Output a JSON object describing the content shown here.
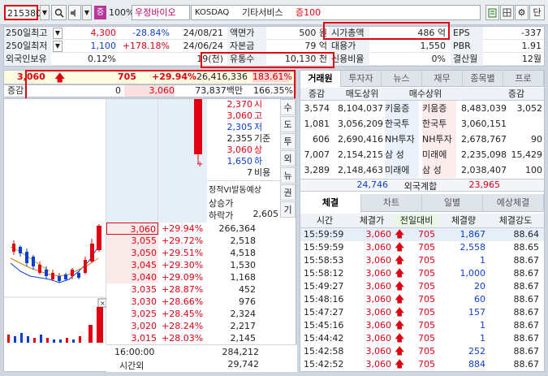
{
  "toolbar": {
    "code": "215380",
    "percent_label": "100%",
    "stock_name": "우정바이오",
    "market": "KOSDAQ",
    "sector": "기타서비스",
    "margin": "증100",
    "badge": "증",
    "right_button": "단"
  },
  "info": {
    "rows": [
      {
        "l1": "250일최고",
        "v1": "4,300",
        "p1": "-28.84%",
        "d1": "24/08/21",
        "l2": "액면가",
        "v2": "500 원",
        "l3": "시가총액",
        "v3": "486 억",
        "l4": "EPS",
        "v4": "-337"
      },
      {
        "l1": "250일최저",
        "v1": "1,100",
        "p1": "+178.18%",
        "d1": "24/06/24",
        "l2": "자본금",
        "v2": "79 억",
        "l3": "대용가",
        "v3": "1,550",
        "l4": "PBR",
        "v4": "1.91"
      },
      {
        "l1": "외국인보유",
        "v1": "0.12%",
        "p1": "",
        "d1": "19(천)",
        "l2": "유통수",
        "v2": "10,130 천",
        "l3": "신용비율",
        "v3": "0%",
        "l4": "결산월",
        "v4": "12월"
      }
    ]
  },
  "price": {
    "current": "3,060",
    "change": "705",
    "change_pct": "+29.94%",
    "volume": "26,416,336",
    "vol_ratio": "183.61%",
    "row2_label": "증감",
    "row2_a": "0",
    "row2_b": "3,060",
    "row2_c": "73,837백만",
    "row2_d": "166.35%"
  },
  "summary": {
    "lines": [
      {
        "v": "2,370",
        "l": "시"
      },
      {
        "v": "3,060",
        "l": "고"
      },
      {
        "v": "2,305",
        "l": "저"
      },
      {
        "v": "2,355",
        "l": "기준"
      },
      {
        "v": "3,060",
        "l": "상"
      },
      {
        "v": "1,650",
        "l": "하"
      },
      {
        "v": "7",
        "l": "비용"
      }
    ],
    "side_btns": [
      "수",
      "도",
      "투",
      "외",
      "뉴",
      "권",
      "기"
    ],
    "vi_title": "정적VI발동예상",
    "vi_up_label": "상승가",
    "vi_up": "",
    "vi_down_label": "하락가",
    "vi_down": "2,605"
  },
  "bids": [
    {
      "price": "3,060",
      "pct": "+29.94%",
      "qty": "266,364"
    },
    {
      "price": "3,055",
      "pct": "+29.72%",
      "qty": "2,518"
    },
    {
      "price": "3,050",
      "pct": "+29.51%",
      "qty": "4,518"
    },
    {
      "price": "3,045",
      "pct": "+29.30%",
      "qty": "1,530"
    },
    {
      "price": "3,040",
      "pct": "+29.09%",
      "qty": "1,168"
    },
    {
      "price": "3,035",
      "pct": "+28.87%",
      "qty": "452"
    },
    {
      "price": "3,030",
      "pct": "+28.66%",
      "qty": "976"
    },
    {
      "price": "3,025",
      "pct": "+28.45%",
      "qty": "2,324"
    },
    {
      "price": "3,020",
      "pct": "+28.24%",
      "qty": "2,217"
    },
    {
      "price": "3,015",
      "pct": "+28.03%",
      "qty": "2,145"
    }
  ],
  "bottom": {
    "time": "16:00:00",
    "total": "284,212",
    "after_label": "시간외",
    "after": "29,742"
  },
  "broker": {
    "tabs": [
      "거래원",
      "투자자",
      "뉴스",
      "재무",
      "종목별",
      "프로"
    ],
    "headers": [
      "증감",
      "매도상위",
      "매수상위",
      "증감"
    ],
    "rows": [
      {
        "a": "3,574",
        "sq": "8,104,037",
        "sn": "키움증",
        "bn": "키움증",
        "bq": "8,483,039",
        "b": "3,052"
      },
      {
        "a": "1,081",
        "sq": "3,056,209",
        "sn": "한국투",
        "bn": "한국투",
        "bq": "3,060,151",
        "b": ""
      },
      {
        "a": "606",
        "sq": "2,690,416",
        "sn": "NH투자",
        "bn": "NH투자",
        "bq": "2,678,767",
        "b": "90"
      },
      {
        "a": "7,007",
        "sq": "2,154,215",
        "sn": "삼 성",
        "bn": "미래에",
        "bq": "2,235,098",
        "b": "15,429"
      },
      {
        "a": "3,289",
        "sq": "2,148,463",
        "sn": "미래에",
        "bn": "삼 성",
        "bq": "2,038,407",
        "b": "100"
      }
    ],
    "foreign_sell": "24,746",
    "foreign_label": "외국계합",
    "foreign_buy": "23,965"
  },
  "trades": {
    "tabs": [
      "체결",
      "차트",
      "일별",
      "예상체결"
    ],
    "headers": [
      "시간",
      "체결가",
      "전일대비",
      "체결량",
      "체결강도"
    ],
    "rows": [
      {
        "t": "15:59:59",
        "p": "3,060",
        "c": "705",
        "q": "1,867",
        "s": "88.64"
      },
      {
        "t": "15:59:59",
        "p": "3,060",
        "c": "705",
        "q": "2,558",
        "s": "88.65"
      },
      {
        "t": "15:58:53",
        "p": "3,060",
        "c": "705",
        "q": "1",
        "s": "88.67"
      },
      {
        "t": "15:58:12",
        "p": "3,060",
        "c": "705",
        "q": "1,000",
        "s": "88.67"
      },
      {
        "t": "15:49:27",
        "p": "3,060",
        "c": "705",
        "q": "20",
        "s": "88.67"
      },
      {
        "t": "15:48:16",
        "p": "3,060",
        "c": "705",
        "q": "60",
        "s": "88.67"
      },
      {
        "t": "15:47:27",
        "p": "3,060",
        "c": "705",
        "q": "157",
        "s": "88.67"
      },
      {
        "t": "15:45:16",
        "p": "3,060",
        "c": "705",
        "q": "1",
        "s": "88.67"
      },
      {
        "t": "15:44:42",
        "p": "3,060",
        "c": "705",
        "q": "1",
        "s": "88.67"
      },
      {
        "t": "15:42:58",
        "p": "3,060",
        "c": "705",
        "q": "252",
        "s": "88.67"
      },
      {
        "t": "15:42:52",
        "p": "3,060",
        "c": "705",
        "q": "884",
        "s": "88.67"
      }
    ]
  },
  "colors": {
    "up": "#e00012",
    "down": "#0b3fd1",
    "highlight": "#e4000f"
  }
}
